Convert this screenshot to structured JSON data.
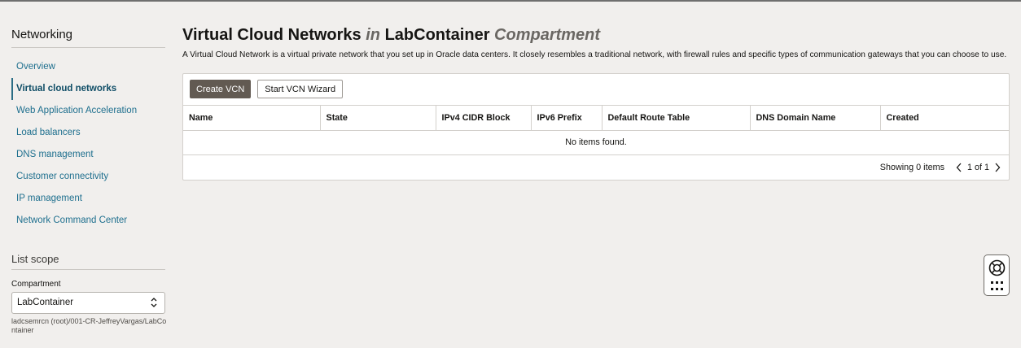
{
  "sidebar": {
    "title": "Networking",
    "items": [
      {
        "label": "Overview"
      },
      {
        "label": "Virtual cloud networks"
      },
      {
        "label": "Web Application Acceleration"
      },
      {
        "label": "Load balancers"
      },
      {
        "label": "DNS management"
      },
      {
        "label": "Customer connectivity"
      },
      {
        "label": "IP management"
      },
      {
        "label": "Network Command Center"
      }
    ],
    "active_index": 1,
    "scope": {
      "title": "List scope",
      "compartment_label": "Compartment",
      "compartment_value": "LabContainer",
      "compartment_path": "ladcsemrcn (root)/001-CR-JeffreyVargas/LabContainer"
    }
  },
  "main": {
    "title": "Virtual Cloud Networks",
    "title_in": "in",
    "compartment": "LabContainer",
    "compartment_word": "Compartment",
    "description": "A Virtual Cloud Network is a virtual private network that you set up in Oracle data centers. It closely resembles a traditional network, with firewall rules and specific types of communication gateways that you can choose to use.",
    "buttons": {
      "create": "Create VCN",
      "wizard": "Start VCN Wizard"
    },
    "table": {
      "columns": [
        "Name",
        "State",
        "IPv4 CIDR Block",
        "IPv6 Prefix",
        "Default Route Table",
        "DNS Domain Name",
        "Created"
      ],
      "empty_text": "No items found."
    },
    "pagination": {
      "showing": "Showing 0 items",
      "page": "1 of 1"
    }
  },
  "help_widget": {
    "icons": [
      "lifebuoy-icon",
      "grid-icon"
    ]
  },
  "colors": {
    "link": "#1e6f8e",
    "primary_button": "#625a52",
    "background": "#f1efed"
  }
}
